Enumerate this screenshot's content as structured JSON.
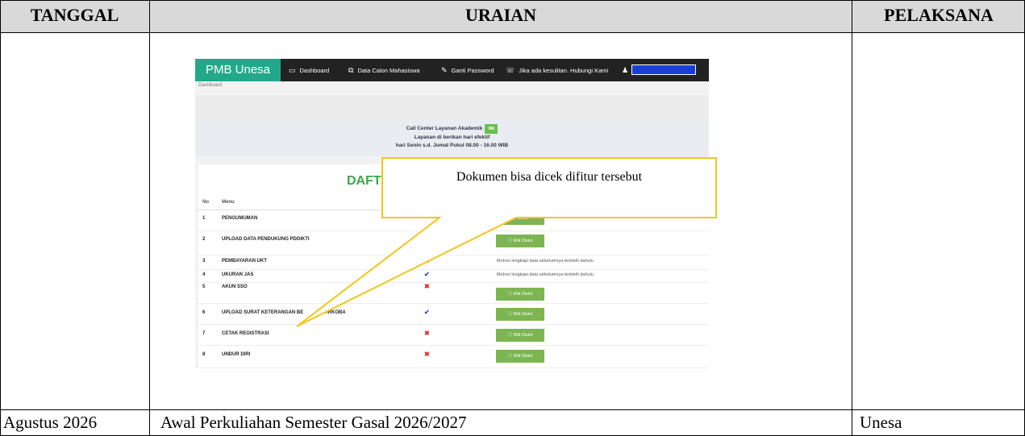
{
  "headers": {
    "tanggal": "TANGGAL",
    "uraian": "URAIAN",
    "pelaksana": "PELAKSANA"
  },
  "row": {
    "tanggal": "Agustus 2026",
    "uraian": "Awal Perkuliahan Semester Gasal 2026/2027",
    "pelaksana": "Unesa"
  },
  "screenshot": {
    "brand": "PMB Unesa",
    "nav": {
      "dashboard": "Dashboard",
      "data_calon": "Data Calon Mahasiswa",
      "ganti_password": "Ganti Password",
      "bantuan": "Jika ada kesulitan. Hubungi Kami"
    },
    "user_bar_color": "#1a3fd6",
    "breadcrumb": "Dashboard",
    "call_center": {
      "line1": "Call Center Layanan Akademik",
      "wa": "WA",
      "line2": "Layanan di berikan hari efektif",
      "line3": "hari Senin s.d. Jumat Pukul 08.00 - 16.00 WIB"
    },
    "panel_title": "DAFT",
    "table_headers": {
      "no": "No",
      "menu": "Menu"
    },
    "rows": [
      {
        "no": "1",
        "menu": "PENGUMUMAN",
        "status": "",
        "note": "",
        "button": "Disini"
      },
      {
        "no": "2",
        "menu": "UPLOAD DATA PENDUKUNG PDDIKTI",
        "status": "",
        "note": "",
        "button": "Klik Disini"
      },
      {
        "no": "3",
        "menu": "PEMBAYARAN UKT",
        "status": "✖",
        "note": "Mohon lengkapi data sebelumnya terlebih dahulu.",
        "button": ""
      },
      {
        "no": "4",
        "menu": "UKURAN JAS",
        "status": "✔",
        "note": "Mohon lengkapi data sebelumnya terlebih dahulu.",
        "button": ""
      },
      {
        "no": "5",
        "menu": "AKUN SSO",
        "status": "✖",
        "note": "",
        "button": "Klik Disini"
      },
      {
        "no": "6",
        "menu": "UPLOAD SURAT KETERANGAN BE",
        "menu_tail": "NARKOBA",
        "status": "✔",
        "note": "",
        "button": "Klik Disini"
      },
      {
        "no": "7",
        "menu": "CETAK REGISTRASI",
        "status": "✖",
        "note": "",
        "button": "Klik Disini"
      },
      {
        "no": "8",
        "menu": "UNDUR DIRI",
        "status": "✖",
        "note": "",
        "button": "Klik Disini"
      }
    ]
  },
  "callout": {
    "text": "Dokumen bisa dicek difitur tersebut",
    "border_color": "#f5c518"
  }
}
